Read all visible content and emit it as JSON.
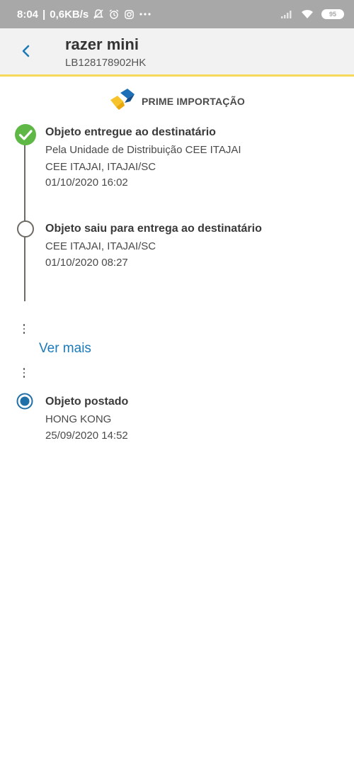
{
  "status_bar": {
    "time": "8:04",
    "speed": "0,6KB/s",
    "battery": "95"
  },
  "header": {
    "title": "razer mini",
    "tracking_code": "LB128178902HK"
  },
  "brand": {
    "label": "PRIME IMPORTAÇÃO"
  },
  "events": [
    {
      "title": "Objeto entregue ao destinatário",
      "line1": "Pela Unidade de Distribuição CEE ITAJAI",
      "line2": "CEE ITAJAI, ITAJAI/SC",
      "line3": "01/10/2020 16:02"
    },
    {
      "title": "Objeto saiu para entrega ao destinatário",
      "line1": "CEE ITAJAI, ITAJAI/SC",
      "line2": "01/10/2020 08:27"
    },
    {
      "title": "Objeto postado",
      "line1": "HONG KONG",
      "line2": "25/09/2020 14:52"
    }
  ],
  "ver_mais": "Ver mais",
  "colors": {
    "accent_yellow": "#f6d85a",
    "delivered_green": "#5fb845",
    "link_blue": "#1a7ab8",
    "posted_blue": "#1f6fa8"
  }
}
